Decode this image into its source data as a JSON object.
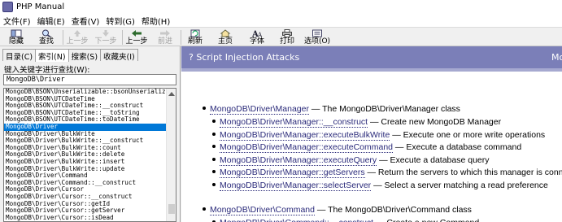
{
  "window": {
    "title": "PHP Manual"
  },
  "menu": [
    "文件(F)",
    "编辑(E)",
    "查看(V)",
    "转到(G)",
    "帮助(H)"
  ],
  "toolbar": {
    "hide": "隐藏",
    "find": "查找",
    "up_prev": "上一步",
    "down_next": "下一步",
    "back": "上一步",
    "forward": "前进",
    "refresh": "刷新",
    "home": "主页",
    "font": "字体",
    "print": "打印",
    "options": "选项(O)"
  },
  "left": {
    "tabs": [
      "目录(C)",
      "索引(N)",
      "搜索(S)",
      "收藏夹(I)"
    ],
    "keyword_label": "键入关键字进行查找(W):",
    "keyword_value": "MongoDB\\Driver",
    "index_items": [
      "MongoDB\\BSON\\Unserializable::bsonUnserialize",
      "MongoDB\\BSON\\UTCDateTime",
      "MongoDB\\BSON\\UTCDateTime::__construct",
      "MongoDB\\BSON\\UTCDateTime::__toString",
      "MongoDB\\BSON\\UTCDateTime::toDateTime",
      "MongoDB\\Driver",
      "MongoDB\\Driver\\BulkWrite",
      "MongoDB\\Driver\\BulkWrite::__construct",
      "MongoDB\\Driver\\BulkWrite::count",
      "MongoDB\\Driver\\BulkWrite::delete",
      "MongoDB\\Driver\\BulkWrite::insert",
      "MongoDB\\Driver\\BulkWrite::update",
      "MongoDB\\Driver\\Command",
      "MongoDB\\Driver\\Command::__construct",
      "MongoDB\\Driver\\Cursor",
      "MongoDB\\Driver\\Cursor::__construct",
      "MongoDB\\Driver\\Cursor::getId",
      "MongoDB\\Driver\\Cursor::getServer",
      "MongoDB\\Driver\\Cursor::isDead"
    ],
    "selected_item": "MongoDB\\Driver"
  },
  "right": {
    "header_title": "? Script Injection Attacks",
    "header_right": "Mo",
    "manager_link": "MongoDB\\Driver\\Manager",
    "manager_desc": " — The MongoDB\\Driver\\Manager class",
    "manager_methods": [
      {
        "link": "MongoDB\\Driver\\Manager::__construct",
        "desc": " — Create new MongoDB Manager"
      },
      {
        "link": "MongoDB\\Driver\\Manager::executeBulkWrite",
        "desc": " — Execute one or more write operations"
      },
      {
        "link": "MongoDB\\Driver\\Manager::executeCommand",
        "desc": " — Execute a database command"
      },
      {
        "link": "MongoDB\\Driver\\Manager::executeQuery",
        "desc": " — Execute a database query"
      },
      {
        "link": "MongoDB\\Driver\\Manager::getServers",
        "desc": " — Return the servers to which this manager is conne"
      },
      {
        "link": "MongoDB\\Driver\\Manager::selectServer",
        "desc": " — Select a server matching a read preference"
      }
    ],
    "command_link": "MongoDB\\Driver\\Command",
    "command_desc": " — The MongoDB\\Driver\\Command class",
    "command_methods": [
      {
        "link": "MongoDB\\Driver\\Command::__construct",
        "desc": " — Create a new Command"
      }
    ]
  }
}
